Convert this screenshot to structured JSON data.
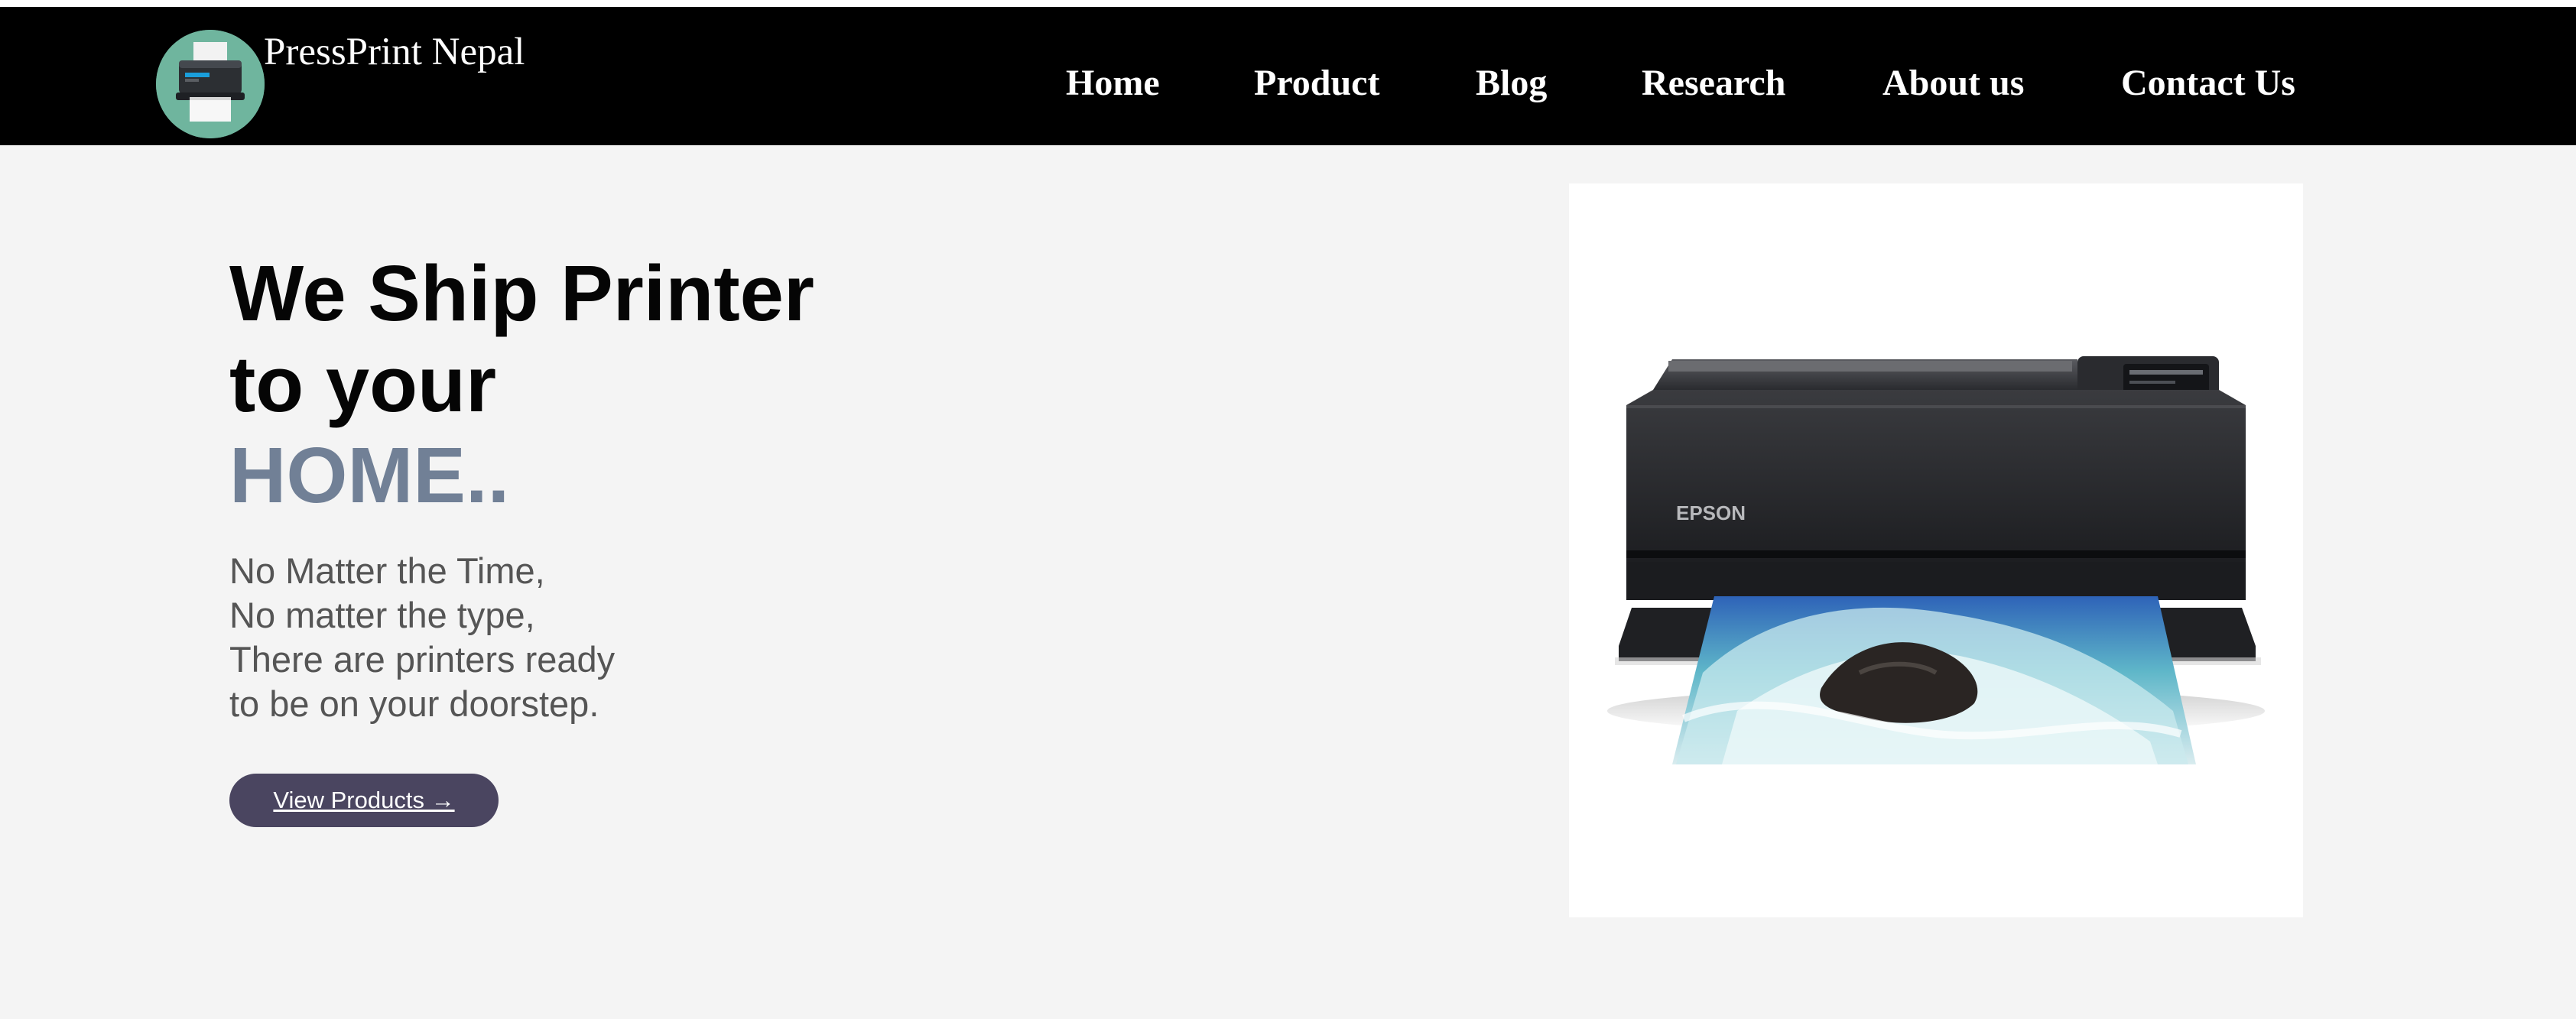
{
  "brand": {
    "name": "PressPrint Nepal",
    "logo_icon": "printer-icon",
    "logo_bg": "#6fb59e"
  },
  "nav": {
    "items": [
      {
        "label": "Home"
      },
      {
        "label": "Product"
      },
      {
        "label": "Blog"
      },
      {
        "label": "Research"
      },
      {
        "label": "About us"
      },
      {
        "label": "Contact Us"
      }
    ]
  },
  "hero": {
    "headline_line1": "We Ship Printer",
    "headline_line2": "to your",
    "headline_accent": "HOME..",
    "subtext": [
      "No Matter the Time,",
      "No matter the type,",
      "There are printers ready",
      "to be on your doorstep."
    ],
    "cta_label": "View Products →",
    "product_brand_text": "EPSON",
    "product_image": "epson-photo-printer-image"
  },
  "colors": {
    "navbar": "#000000",
    "hero_bg": "#f4f4f4",
    "accent_text": "#718096",
    "cta_bg": "#4a4560"
  }
}
